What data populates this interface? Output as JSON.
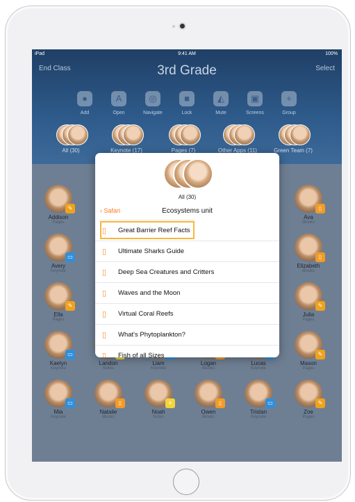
{
  "status_bar": {
    "device": "iPad",
    "time": "9:41 AM",
    "battery": "100%"
  },
  "header": {
    "left_action": "End Class",
    "title": "3rd Grade",
    "right_action": "Select"
  },
  "tools": [
    "Add",
    "Open",
    "Navigate",
    "Lock",
    "Mute",
    "Screens",
    "Group"
  ],
  "groups": [
    "All (30)",
    "Keynote (17)",
    "Pages (7)",
    "Other Apps (11)",
    "Green Team (7)"
  ],
  "popup": {
    "count": "All (30)",
    "back_label": "Safari",
    "title": "Ecosystems unit",
    "items": [
      "Great Barrier Reef Facts",
      "Ultimate Sharks Guide",
      "Deep Sea Creatures and Critters",
      "Waves and the Moon",
      "Virtual Coral Reefs",
      "What's Phytoplankton?",
      "Fish of all Sizes"
    ]
  },
  "students": [
    {
      "name": "Addison",
      "app": "Pages"
    },
    {
      "name": "Ava",
      "app": "iBooks"
    },
    {
      "name": "Avery",
      "app": "Keynote"
    },
    {
      "name": "Elizabeth",
      "app": "iBooks"
    },
    {
      "name": "Ella",
      "app": "Pages"
    },
    {
      "name": "Julia",
      "app": "Pages"
    },
    {
      "name": "Kaelyn",
      "app": "Keynote"
    },
    {
      "name": "Landon",
      "app": "Notes"
    },
    {
      "name": "Liam",
      "app": "Keynote"
    },
    {
      "name": "Logan",
      "app": "iBooks"
    },
    {
      "name": "Lucas",
      "app": "Keynote"
    },
    {
      "name": "Mason",
      "app": "Pages"
    },
    {
      "name": "Mia",
      "app": "Keynote"
    },
    {
      "name": "Natalie",
      "app": "iBooks"
    },
    {
      "name": "Noah",
      "app": "Notes"
    },
    {
      "name": "Owen",
      "app": "iBooks"
    },
    {
      "name": "Tristan",
      "app": "Keynote"
    },
    {
      "name": "Zoe",
      "app": "Pages"
    }
  ],
  "colors": {
    "accent": "#ff7a1a",
    "highlight": "#f5b73b",
    "pages": "#f0a21c",
    "keynote": "#2f8fdc",
    "ibooks": "#f29b25",
    "notes": "#f5d33b"
  }
}
